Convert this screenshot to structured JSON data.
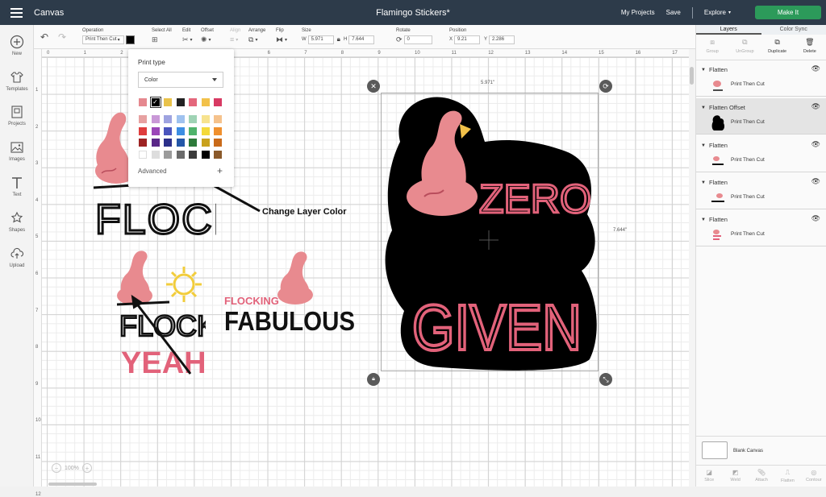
{
  "topbar": {
    "app_title": "Canvas",
    "document_title": "Flamingo Stickers*",
    "my_projects": "My Projects",
    "save": "Save",
    "explore": "Explore",
    "make_it": "Make It"
  },
  "toolbar": {
    "undo_icon": "undo-icon",
    "redo_icon": "redo-icon",
    "operation_label": "Operation",
    "operation_value": "Print Then Cut",
    "select_all_label": "Select All",
    "edit_label": "Edit",
    "offset_label": "Offset",
    "align_label": "Align",
    "arrange_label": "Arrange",
    "flip_label": "Flip",
    "size_label": "Size",
    "width_prefix": "W",
    "width_value": "5.971",
    "height_prefix": "H",
    "height_value": "7.644",
    "rotate_label": "Rotate",
    "rotate_value": "0",
    "position_label": "Position",
    "x_prefix": "X",
    "x_value": "9.21",
    "y_prefix": "Y",
    "y_value": "2.286"
  },
  "leftbar": {
    "items": [
      {
        "label": "New",
        "icon": "plus-circle-icon"
      },
      {
        "label": "Templates",
        "icon": "shirt-icon"
      },
      {
        "label": "Projects",
        "icon": "projects-icon"
      },
      {
        "label": "Images",
        "icon": "image-icon"
      },
      {
        "label": "Text",
        "icon": "text-icon"
      },
      {
        "label": "Shapes",
        "icon": "shapes-icon"
      },
      {
        "label": "Upload",
        "icon": "cloud-upload-icon"
      }
    ]
  },
  "ruler": {
    "top": [
      "0",
      "1",
      "2",
      "3",
      "4",
      "5",
      "6",
      "7",
      "8",
      "9",
      "10",
      "11",
      "12",
      "13",
      "14",
      "15",
      "16",
      "17"
    ],
    "left": [
      "1",
      "2",
      "3",
      "4",
      "5",
      "6",
      "7",
      "8",
      "9",
      "10",
      "11",
      "12"
    ]
  },
  "popup": {
    "title": "Print type",
    "select_value": "Color",
    "top_swatches": [
      "#e5888f",
      "#000000",
      "#e9c24a",
      "#222222",
      "#e4677c",
      "#f2c14a",
      "#d83a63"
    ],
    "swatch_grid": [
      [
        "#e7a1a1",
        "#c998d7",
        "#9ea3e0",
        "#9fc2ef",
        "#9fd3b5",
        "#f7e38f",
        "#f5c28c"
      ],
      [
        "#df3d3d",
        "#9a46b8",
        "#4a55bd",
        "#3d8ee3",
        "#4fb36b",
        "#f4d93a",
        "#f0902e"
      ],
      [
        "#9d2323",
        "#5a2788",
        "#2b2f8a",
        "#2457a8",
        "#2d7a3a",
        "#c9a11c",
        "#c96a1a"
      ],
      [
        "#ffffff",
        "#dddddd",
        "#9b9b9b",
        "#6b6b6b",
        "#3b3b3b",
        "#000000",
        "#8b5a2b"
      ]
    ],
    "advanced": "Advanced"
  },
  "annotation": "Change Layer Color",
  "canvas": {
    "width_readout": "5.971\"",
    "height_readout": "7.644\"",
    "zoom": "100%",
    "designs": {
      "flock_text": "FLOCK?",
      "flock_yeah_top": "FLOCK",
      "flock_yeah_bottom": "YEAH!",
      "flocking": "FLOCKING",
      "fabulous": "FABULOUS",
      "zero": "ZERO",
      "given": "GIVEN"
    }
  },
  "rpanel": {
    "tabs": [
      "Layers",
      "Color Sync"
    ],
    "actions": [
      {
        "label": "Group",
        "icon": "group-icon",
        "enabled": false
      },
      {
        "label": "UnGroup",
        "icon": "ungroup-icon",
        "enabled": false
      },
      {
        "label": "Duplicate",
        "icon": "duplicate-icon",
        "enabled": true
      },
      {
        "label": "Delete",
        "icon": "trash-icon",
        "enabled": true
      }
    ],
    "layers": [
      {
        "title": "Flatten",
        "sub": "Print Then Cut"
      },
      {
        "title": "Flatten Offset",
        "sub": "Print Then Cut"
      },
      {
        "title": "Flatten",
        "sub": "Print Then Cut"
      },
      {
        "title": "Flatten",
        "sub": "Print Then Cut"
      },
      {
        "title": "Flatten",
        "sub": "Print Then Cut"
      }
    ],
    "blank_canvas": "Blank Canvas",
    "bottom": [
      "Slice",
      "Weld",
      "Attach",
      "Flatten",
      "Contour"
    ]
  }
}
